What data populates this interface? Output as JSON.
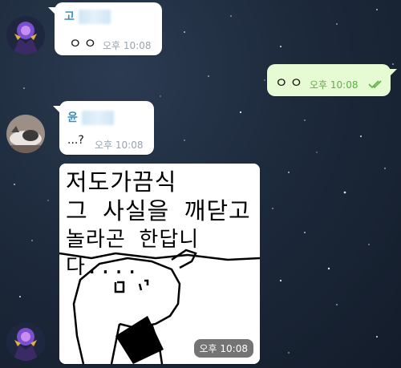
{
  "messages": [
    {
      "sender": "고",
      "text": "ㅇㅇ",
      "time": "오후 10:08"
    },
    {
      "text": "ㅇㅇ",
      "time": "오후 10:08",
      "status": "read-double-check"
    },
    {
      "sender": "윤",
      "text": "...?",
      "time": "오후 10:08"
    },
    {
      "image_text": [
        "저도가끔식",
        "그 사실을 깨닫고",
        "놀라곤 한답니다...."
      ],
      "time": "오후 10:08"
    }
  ],
  "icons": {
    "read_receipt": "double-check-icon"
  },
  "colors": {
    "incoming_bubble": "#ffffff",
    "outgoing_bubble": "#e6fbd3",
    "sender_name": "#3a8fc0",
    "outgoing_time": "#5fae47",
    "background": "#1d2a3c"
  }
}
